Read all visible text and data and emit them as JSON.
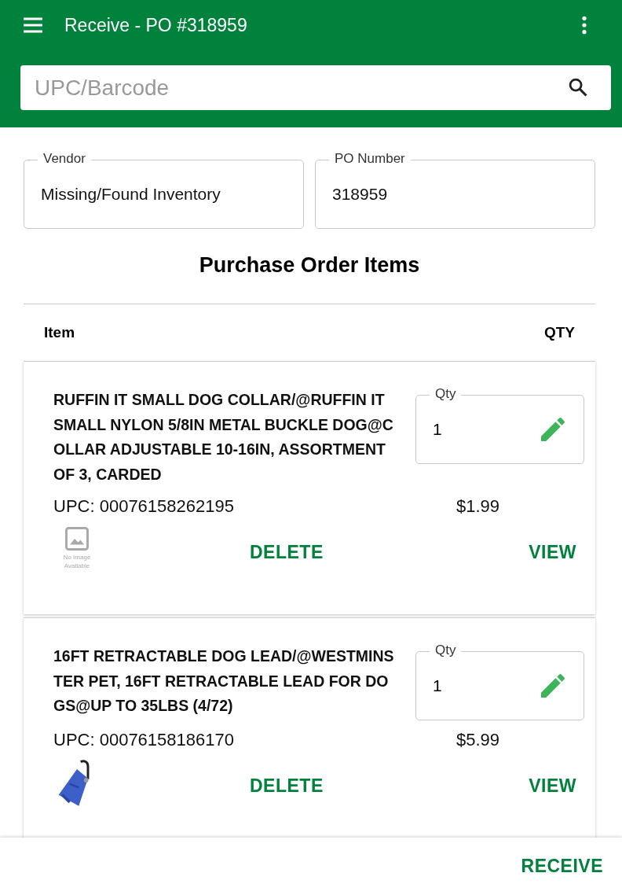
{
  "app_bar": {
    "title": "Receive - PO #318959"
  },
  "search": {
    "placeholder": "UPC/Barcode"
  },
  "fields": [
    {
      "label": "Vendor",
      "value": "Missing/Found Inventory"
    },
    {
      "label": "PO Number",
      "value": "318959"
    }
  ],
  "section_title": "Purchase Order Items",
  "columns": [
    "Item",
    "QTY"
  ],
  "items": [
    {
      "name": "RUFFIN IT SMALL DOG COLLAR/@RUFFIN IT SMALL NYLON 5/8IN METAL BUCKLE DOG@COLLAR ADJUSTABLE 10-16IN, ASSORTMENT OF 3, CARDED",
      "qty_label": "Qty",
      "qty": "1",
      "upc": "UPC: 00076158262195",
      "price": "$1.99",
      "image": {
        "kind": "placeholder",
        "caption": "No Image Available"
      },
      "actions": [
        "DELETE",
        "VIEW"
      ]
    },
    {
      "name": "16FT RETRACTABLE DOG LEAD/@WESTMINSTER PET, 16FT RETRACTABLE LEAD FOR DOGS@UP TO 35LBS (4/72)",
      "qty_label": "Qty",
      "qty": "1",
      "upc": "UPC: 00076158186170",
      "price": "$5.99",
      "actions": [
        "DELETE",
        "VIEW"
      ]
    }
  ],
  "footer": {
    "button": "RECEIVE"
  }
}
